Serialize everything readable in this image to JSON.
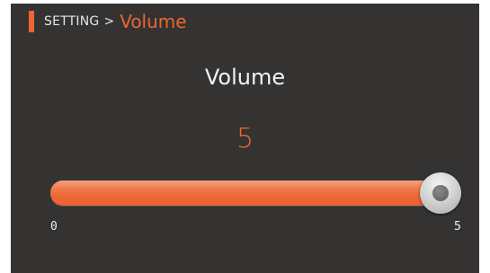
{
  "breadcrumb": {
    "parent": "SETTING",
    "separator": ">",
    "current": "Volume"
  },
  "title": "Volume",
  "volume": {
    "value": "5",
    "min_label": "0",
    "max_label": "5",
    "level_fraction": 1.0
  },
  "colors": {
    "accent": "#ee6530",
    "background": "#343332",
    "text": "#f2f2f2"
  },
  "icons": {
    "header_marker": "orange-bar",
    "slider_thumb": "round-knob"
  }
}
